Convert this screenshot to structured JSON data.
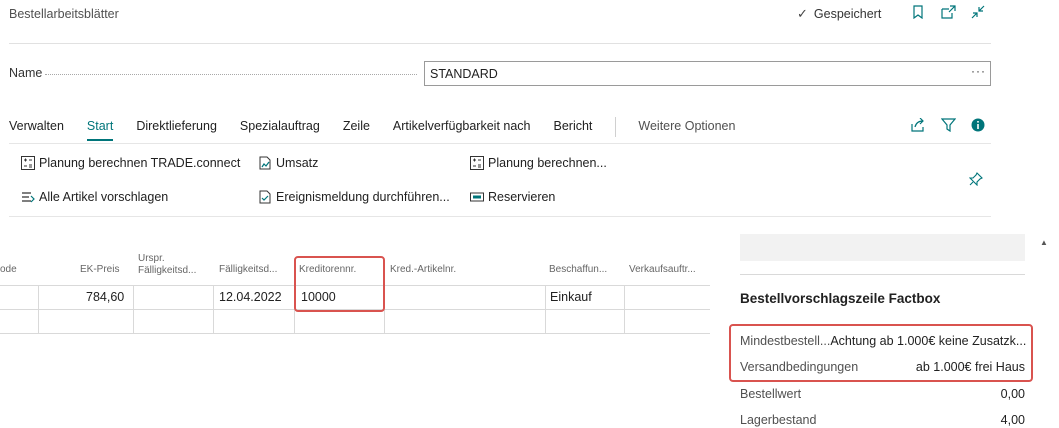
{
  "header": {
    "title": "Bestellarbeitsblätter",
    "saved_label": "Gespeichert",
    "saved_icon": "checkmark-icon"
  },
  "name_field": {
    "label": "Name",
    "value": "STANDARD",
    "more": "···"
  },
  "menu": {
    "items": [
      "Verwalten",
      "Start",
      "Direktlieferung",
      "Spezialauftrag",
      "Zeile",
      "Artikelverfügbarkeit nach",
      "Bericht"
    ],
    "active": "Start",
    "more": "Weitere Optionen"
  },
  "actions": {
    "planung_trade": "Planung berechnen TRADE.connect",
    "umsatz": "Umsatz",
    "planung": "Planung berechnen...",
    "alle_artikel": "Alle Artikel vorschlagen",
    "ereignis": "Ereignismeldung durchführen...",
    "reservieren": "Reservieren"
  },
  "grid": {
    "headers": {
      "code": "ode",
      "ek_preis": "EK-Preis",
      "urspr_1": "Urspr.",
      "urspr_2": "Fälligkeitsd...",
      "faellig": "Fälligkeitsd...",
      "kreditor": "Kreditorennr.",
      "kred_artikel": "Kred.-Artikelnr.",
      "beschaffung": "Beschaffun...",
      "verkauf": "Verkaufsauftr..."
    },
    "row1": {
      "ek_preis": "784,60",
      "faellig": "12.04.2022",
      "kreditor": "10000",
      "beschaffung": "Einkauf"
    }
  },
  "factbox": {
    "title": "Bestellvorschlagszeile Factbox",
    "rows": [
      {
        "label": "Mindestbestell...",
        "value": "Achtung ab 1.000€ keine Zusatzk..."
      },
      {
        "label": "Versandbedingungen",
        "value": "ab 1.000€ frei Haus"
      },
      {
        "label": "Bestellwert",
        "value": "0,00"
      },
      {
        "label": "Lagerbestand",
        "value": "4,00"
      }
    ]
  },
  "colors": {
    "accent": "#00757a",
    "highlight": "#d9534f"
  }
}
